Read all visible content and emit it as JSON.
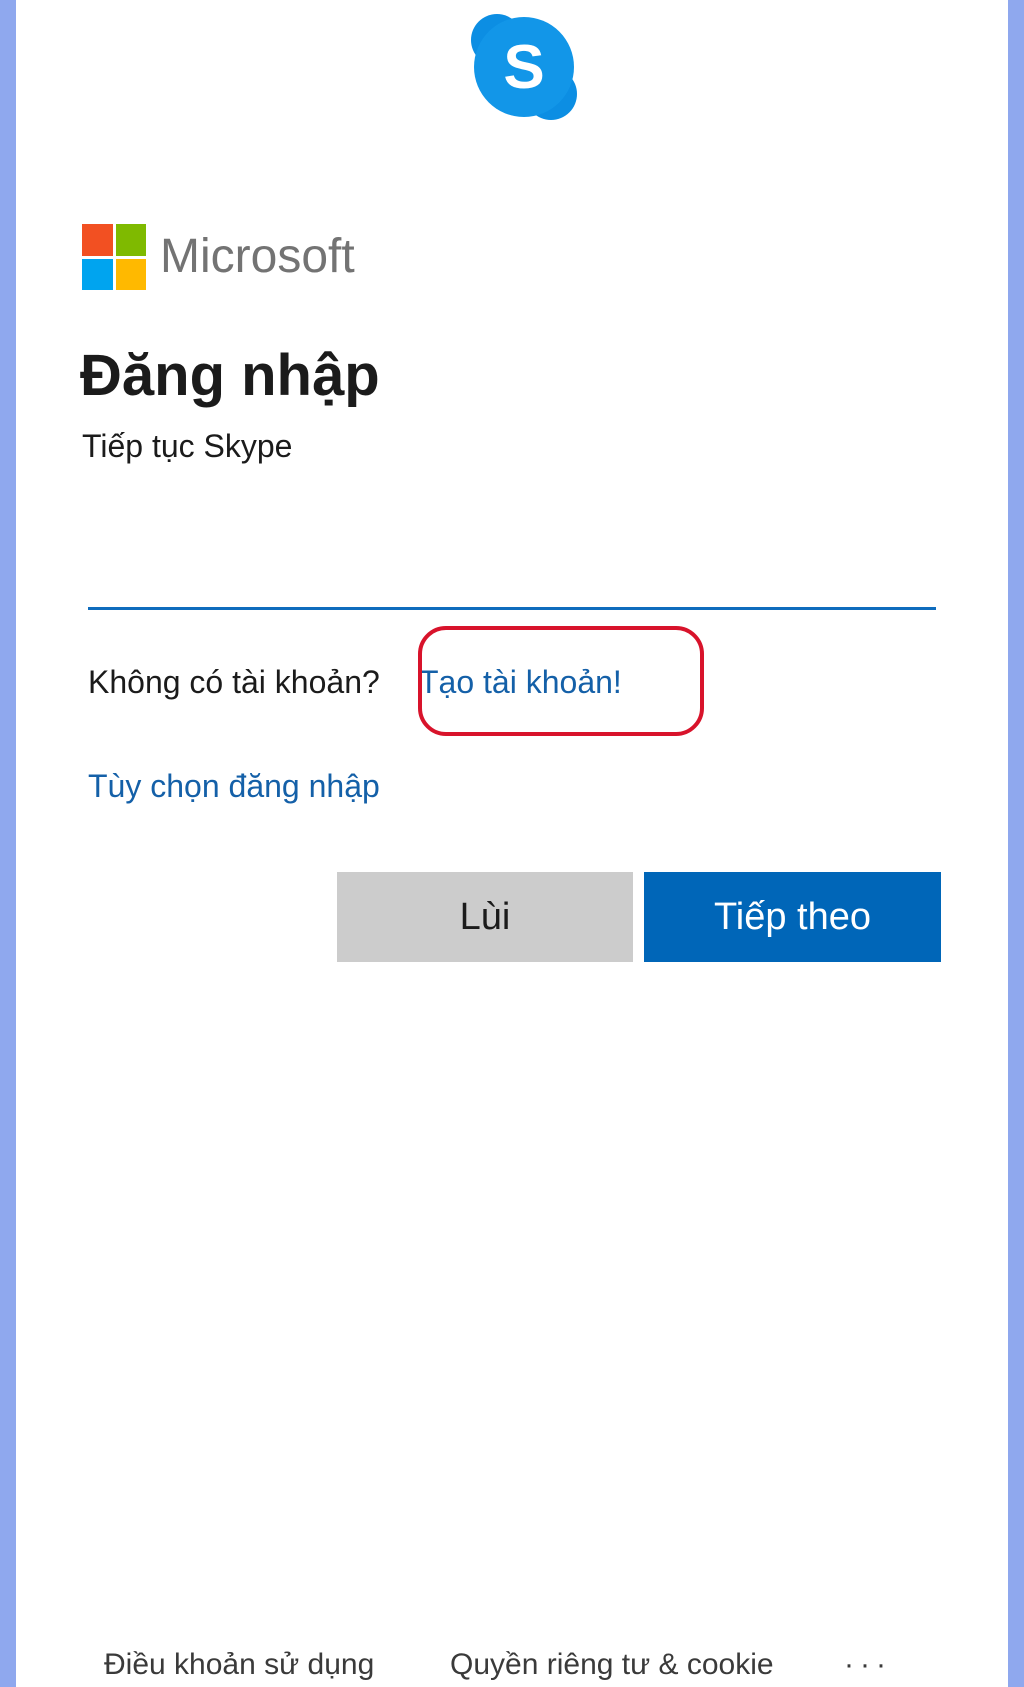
{
  "app": {
    "skype_logo_letter": "S"
  },
  "brand": {
    "name": "Microsoft",
    "colors": {
      "red": "#f25022",
      "green": "#7fba00",
      "blue": "#00a4ef",
      "yellow": "#ffb900",
      "skype": "#0c8ee3"
    }
  },
  "signin": {
    "title": "Đăng nhập",
    "subtitle": "Tiếp tục Skype",
    "email_value": "",
    "email_placeholder": ""
  },
  "account": {
    "no_account_text": "Không có tài khoản?",
    "create_link": "Tạo tài khoản!"
  },
  "options_link": "Tùy chọn đăng nhập",
  "buttons": {
    "back": "Lùi",
    "next": "Tiếp theo"
  },
  "footer": {
    "terms": "Điều khoản sử dụng",
    "privacy": "Quyền riêng tư & cookie",
    "more": "···"
  }
}
